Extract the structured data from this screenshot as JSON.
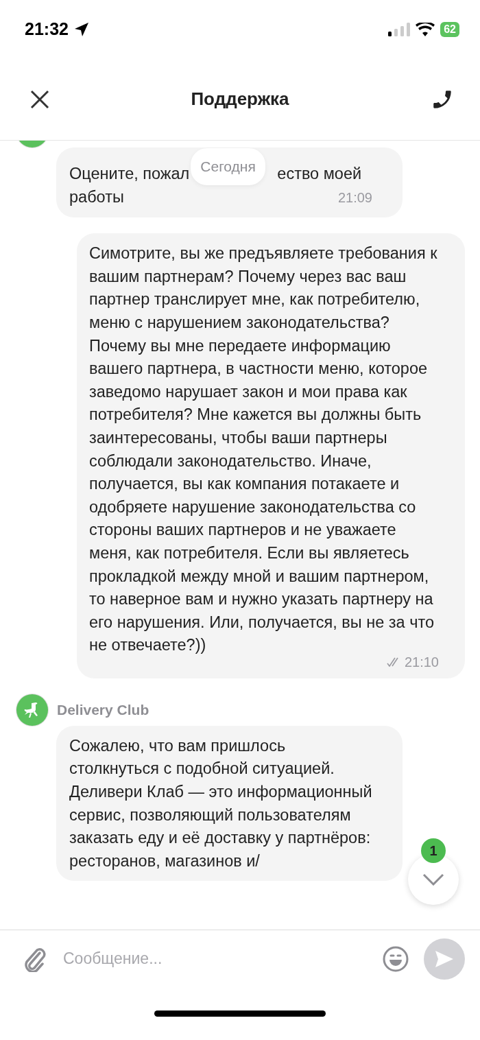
{
  "status_bar": {
    "time": "21:32",
    "battery": "62"
  },
  "header": {
    "title": "Поддержка"
  },
  "date_chip": "Сегодня",
  "messages": [
    {
      "kind": "incoming",
      "text_parts": [
        "Оцените, пожал",
        "ество моей",
        "работы"
      ],
      "time": "21:09"
    },
    {
      "kind": "outgoing",
      "text": "Симотрите, вы же предъявляете требования к вашим партнерам? Почему через вас ваш партнер транслирует мне, как потребителю, меню с нарушением законодательства? Почему вы мне передаете информацию вашего партнера, в частности меню, которое заведомо нарушает закон и мои права как потребителя? Мне кажется вы должны быть заинтересованы, чтобы ваши партнеры соблюдали законодательство. Иначе, получается, вы как компания потакаете и одобряете нарушение законодательства со стороны ваших партнеров и не уважаете меня, как потребителя. Если вы являетесь прокладкой между мной и вашим партнером, то наверное вам и нужно указать партнеру на его нарушения. Или, получается, вы не за что не отвечаете?))",
      "time": "21:10",
      "read": true
    },
    {
      "kind": "incoming",
      "sender": "Delivery Club",
      "text": "Сожалею, что вам пришлось столкнуться с подобной ситуацией. Деливери Клаб — это информационный сервис, позволяющий пользователям заказать еду и её доставку у партнёров: ресторанов, магазинов и/"
    }
  ],
  "scroll_button": {
    "unread_count": "1"
  },
  "composer": {
    "placeholder": "Сообщение..."
  }
}
